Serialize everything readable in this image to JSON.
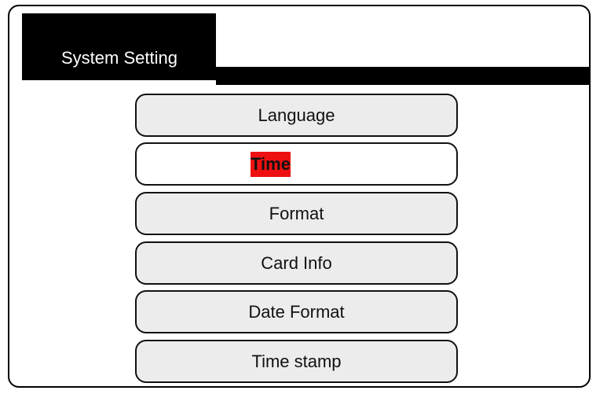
{
  "header": {
    "title": "System Setting"
  },
  "menu": {
    "items": [
      {
        "label": "Language",
        "selected": false
      },
      {
        "label": "Time",
        "selected": true
      },
      {
        "label": "Format",
        "selected": false
      },
      {
        "label": "Card Info",
        "selected": false
      },
      {
        "label": "Date Format",
        "selected": false
      },
      {
        "label": "Time stamp",
        "selected": false
      }
    ],
    "highlight_color": "#ee1111"
  }
}
